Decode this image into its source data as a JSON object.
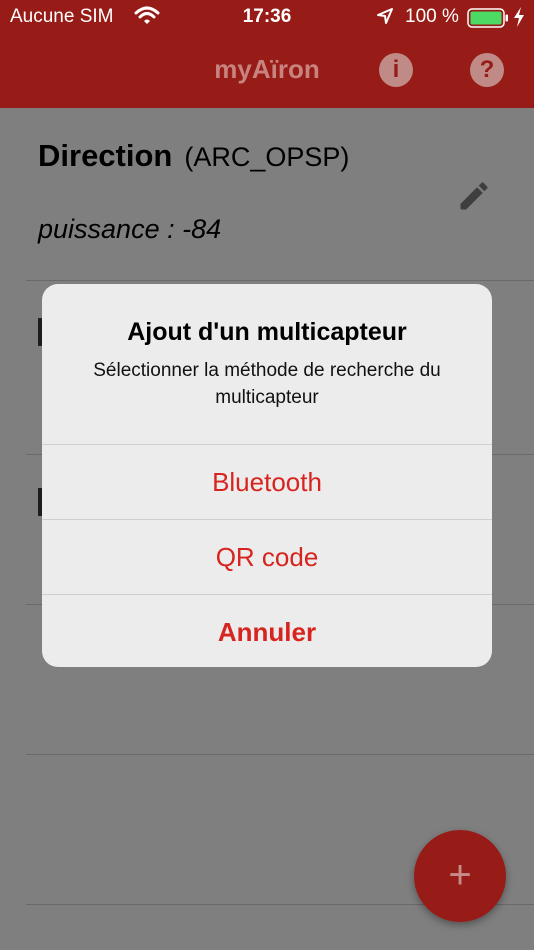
{
  "status_bar": {
    "carrier": "Aucune SIM",
    "wifi_icon": "wifi-icon",
    "time": "17:36",
    "location_icon": "location-arrow-icon",
    "battery_percent": "100 %",
    "battery_icon": "battery-full-icon",
    "charging_icon": "charging-bolt-icon"
  },
  "header": {
    "title": "myAïron",
    "info_icon": "info-icon",
    "help_icon": "help-icon",
    "background_color": "#971c17"
  },
  "list": {
    "items": [
      {
        "name": "Direction",
        "code": "(ARC_OPSP)",
        "subtitle": "puissance : -84",
        "edit_icon": "pencil-icon"
      }
    ]
  },
  "alert": {
    "title": "Ajout d'un multicapteur",
    "message": "Sélectionner la méthode de recherche du multicapteur",
    "buttons": [
      {
        "label": "Bluetooth"
      },
      {
        "label": "QR code"
      },
      {
        "label": "Annuler"
      }
    ],
    "accent_color": "#d8241f"
  },
  "fab": {
    "label": "+",
    "icon": "add-icon"
  }
}
